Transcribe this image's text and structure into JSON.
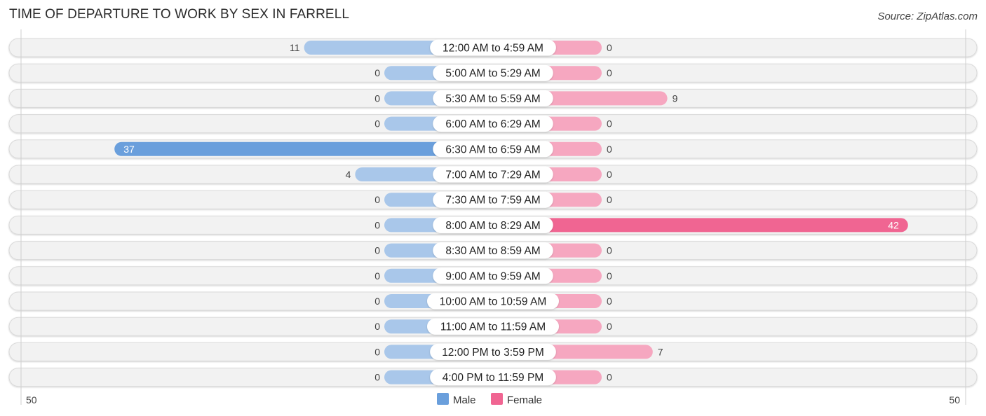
{
  "title": "TIME OF DEPARTURE TO WORK BY SEX IN FARRELL",
  "source": "Source: ZipAtlas.com",
  "colors": {
    "male_strong": "#6a9fdc",
    "male_light": "#a9c7ea",
    "female_strong": "#f06592",
    "female_light": "#f6a7c0",
    "row_bg": "#f2f2f2",
    "row_border": "#d9d9d9"
  },
  "chart_data": {
    "type": "bar",
    "orientation": "horizontal-diverging",
    "title": "TIME OF DEPARTURE TO WORK BY SEX IN FARRELL",
    "categories": [
      "12:00 AM to 4:59 AM",
      "5:00 AM to 5:29 AM",
      "5:30 AM to 5:59 AM",
      "6:00 AM to 6:29 AM",
      "6:30 AM to 6:59 AM",
      "7:00 AM to 7:29 AM",
      "7:30 AM to 7:59 AM",
      "8:00 AM to 8:29 AM",
      "8:30 AM to 8:59 AM",
      "9:00 AM to 9:59 AM",
      "10:00 AM to 10:59 AM",
      "11:00 AM to 11:59 AM",
      "12:00 PM to 3:59 PM",
      "4:00 PM to 11:59 PM"
    ],
    "series": [
      {
        "name": "Male",
        "values": [
          11,
          0,
          0,
          0,
          37,
          4,
          0,
          0,
          0,
          0,
          0,
          0,
          0,
          0
        ]
      },
      {
        "name": "Female",
        "values": [
          0,
          0,
          9,
          0,
          0,
          0,
          0,
          42,
          0,
          0,
          0,
          0,
          7,
          0
        ]
      }
    ],
    "axis": {
      "left_label": "50",
      "right_label": "50",
      "range": [
        -50,
        50
      ]
    },
    "legend": {
      "position": "bottom-center",
      "items": [
        "Male",
        "Female"
      ]
    },
    "grid": false
  }
}
